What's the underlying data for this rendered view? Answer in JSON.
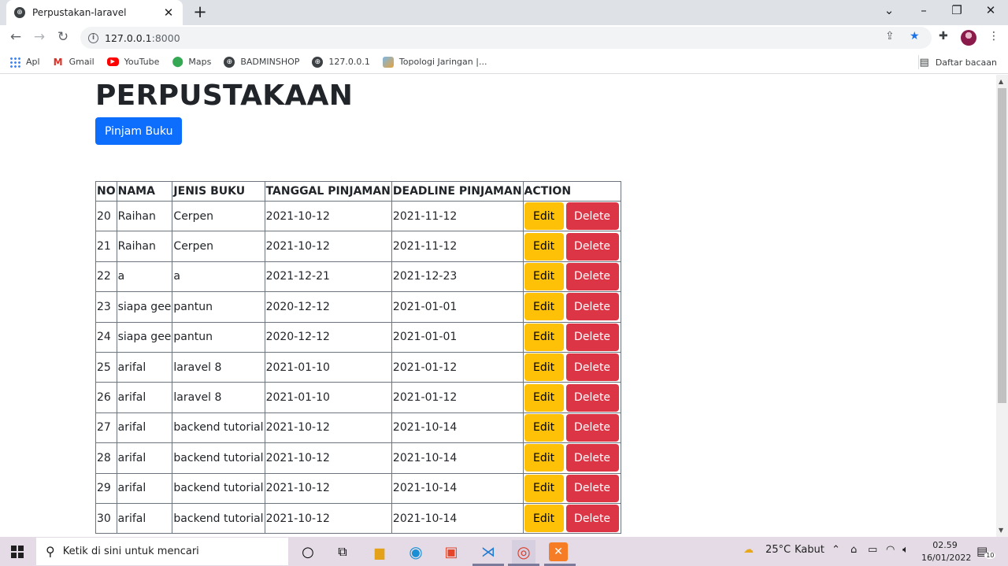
{
  "browser": {
    "tab_title": "Perpustakan-laravel",
    "url_host": "127.0.0.1",
    "url_port": ":8000",
    "bookmarks": [
      "Apl",
      "Gmail",
      "YouTube",
      "Maps",
      "BADMINSHOP",
      "127.0.0.1",
      "Topologi Jaringan |..."
    ],
    "reading_list": "Daftar bacaan"
  },
  "page": {
    "title": "PERPUSTAKAAN",
    "borrow_button": "Pinjam Buku",
    "table": {
      "headers": [
        "NO",
        "NAMA",
        "JENIS BUKU",
        "TANGGAL PINJAMAN",
        "DEADLINE PINJAMAN",
        "ACTION"
      ],
      "edit_label": "Edit",
      "delete_label": "Delete",
      "rows": [
        {
          "no": "20",
          "nama": "Raihan",
          "jenis": "Cerpen",
          "tanggal": "2021-10-12",
          "deadline": "2021-11-12"
        },
        {
          "no": "21",
          "nama": "Raihan",
          "jenis": "Cerpen",
          "tanggal": "2021-10-12",
          "deadline": "2021-11-12"
        },
        {
          "no": "22",
          "nama": "a",
          "jenis": "a",
          "tanggal": "2021-12-21",
          "deadline": "2021-12-23"
        },
        {
          "no": "23",
          "nama": "siapa gee",
          "jenis": "pantun",
          "tanggal": "2020-12-12",
          "deadline": "2021-01-01"
        },
        {
          "no": "24",
          "nama": "siapa gee",
          "jenis": "pantun",
          "tanggal": "2020-12-12",
          "deadline": "2021-01-01"
        },
        {
          "no": "25",
          "nama": "arifal",
          "jenis": "laravel 8",
          "tanggal": "2021-01-10",
          "deadline": "2021-01-12"
        },
        {
          "no": "26",
          "nama": "arifal",
          "jenis": "laravel 8",
          "tanggal": "2021-01-10",
          "deadline": "2021-01-12"
        },
        {
          "no": "27",
          "nama": "arifal",
          "jenis": "backend tutorial",
          "tanggal": "2021-10-12",
          "deadline": "2021-10-14"
        },
        {
          "no": "28",
          "nama": "arifal",
          "jenis": "backend tutorial",
          "tanggal": "2021-10-12",
          "deadline": "2021-10-14"
        },
        {
          "no": "29",
          "nama": "arifal",
          "jenis": "backend tutorial",
          "tanggal": "2021-10-12",
          "deadline": "2021-10-14"
        },
        {
          "no": "30",
          "nama": "arifal",
          "jenis": "backend tutorial",
          "tanggal": "2021-10-12",
          "deadline": "2021-10-14"
        }
      ]
    }
  },
  "taskbar": {
    "search_placeholder": "Ketik di sini untuk mencari",
    "weather_temp": "25°C",
    "weather_text": "Kabut",
    "time": "02.59",
    "date": "16/01/2022",
    "notification_count": "10"
  },
  "colors": {
    "primary": "#0d6efd",
    "warning": "#ffc107",
    "danger": "#dc3545"
  }
}
